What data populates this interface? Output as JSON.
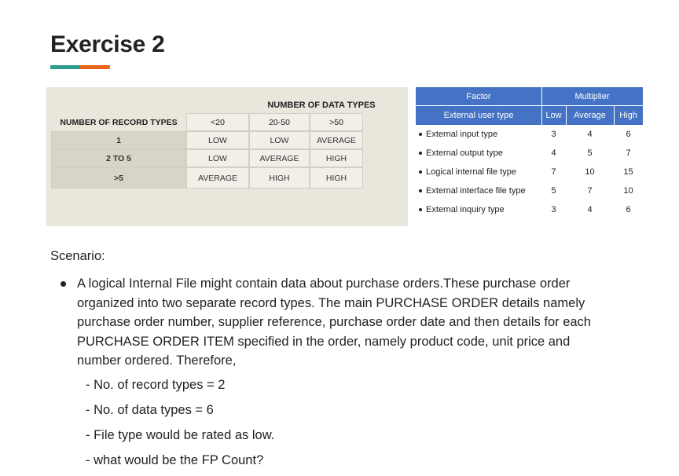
{
  "page": {
    "title": "Exercise 2",
    "accent_colors": [
      "#2e9c8f",
      "#e8651a"
    ]
  },
  "complexity_matrix": {
    "column_group_label": "NUMBER OF DATA TYPES",
    "row_group_label": "NUMBER OF RECORD TYPES",
    "columns": [
      "<20",
      "20-50",
      ">50"
    ],
    "rows": [
      {
        "label": "1",
        "values": [
          "LOW",
          "LOW",
          "AVERAGE"
        ]
      },
      {
        "label": "2 TO 5",
        "values": [
          "LOW",
          "AVERAGE",
          "HIGH"
        ]
      },
      {
        "label": ">5",
        "values": [
          "AVERAGE",
          "HIGH",
          "HIGH"
        ]
      }
    ]
  },
  "multiplier_table": {
    "header_color": "#4472c4",
    "factor_label": "Factor",
    "multiplier_label": "Multiplier",
    "subheader": {
      "factor": "External user type",
      "low": "Low",
      "average": "Average",
      "high": "High"
    },
    "rows": [
      {
        "type": "External input type",
        "low": "3",
        "average": "4",
        "high": "6"
      },
      {
        "type": "External output type",
        "low": "4",
        "average": "5",
        "high": "7"
      },
      {
        "type": "Logical internal file type",
        "low": "7",
        "average": "10",
        "high": "15"
      },
      {
        "type": "External interface file type",
        "low": "5",
        "average": "7",
        "high": "10"
      },
      {
        "type": "External inquiry type",
        "low": "3",
        "average": "4",
        "high": "6"
      }
    ]
  },
  "scenario": {
    "label": "Scenario:",
    "paragraph_lines": [
      "A logical Internal File might contain data about purchase orders.These purchase order",
      "organized into two separate record types. The main PURCHASE ORDER details namely",
      "purchase order number, supplier reference, purchase order date and then details for each",
      "PURCHASE ORDER ITEM specified in the order, namely product code, unit price and",
      "number ordered. Therefore,"
    ],
    "items": [
      "- No. of record types = 2",
      "- No. of data types = 6",
      "- File type would be rated as low.",
      "- what would be the FP Count?"
    ]
  }
}
